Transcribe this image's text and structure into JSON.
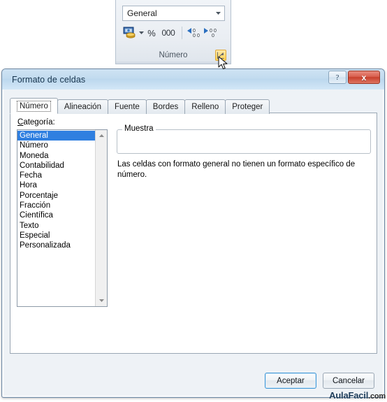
{
  "ribbon": {
    "number_format_combo": {
      "value": "General",
      "caret_icon": "chevron-down-icon"
    },
    "buttons": [
      {
        "name": "currency-format-button",
        "icon": "currency-icon",
        "label": ""
      },
      {
        "name": "currency-dropdown-button",
        "icon": "chevron-down-icon",
        "label": ""
      },
      {
        "name": "percent-style-button",
        "icon": "percent-icon",
        "label": "%"
      },
      {
        "name": "comma-style-button",
        "icon": "thousands-icon",
        "label": "000"
      },
      {
        "name": "increase-decimal-button",
        "icon": "increase-decimal-icon",
        "label": ""
      },
      {
        "name": "decrease-decimal-button",
        "icon": "decrease-decimal-icon",
        "label": ""
      }
    ],
    "group_label": "Número",
    "dialog_launcher": {
      "name": "dialog-launcher-button",
      "icon": "dialog-launcher-icon",
      "highlight_color": "#ffd050"
    }
  },
  "dialog": {
    "title": "Formato de celdas",
    "help_button": "?",
    "close_button": "x",
    "tabs": [
      {
        "label": "Número",
        "active": true
      },
      {
        "label": "Alineación",
        "active": false
      },
      {
        "label": "Fuente",
        "active": false
      },
      {
        "label": "Bordes",
        "active": false
      },
      {
        "label": "Relleno",
        "active": false
      },
      {
        "label": "Proteger",
        "active": false
      }
    ],
    "category": {
      "label_prefix": "C",
      "label_rest": "ategoría:",
      "items": [
        "General",
        "Número",
        "Moneda",
        "Contabilidad",
        "Fecha",
        "Hora",
        "Porcentaje",
        "Fracción",
        "Científica",
        "Texto",
        "Especial",
        "Personalizada"
      ],
      "selected": "General",
      "selected_bg": "#2f7fe0"
    },
    "sample": {
      "legend": "Muestra",
      "value": "",
      "description": "Las celdas con formato general no tienen un formato específico de número."
    },
    "footer": {
      "accept": "Aceptar",
      "cancel": "Cancelar"
    }
  },
  "watermark": {
    "brand": "AulaFacil",
    "suffix": ".com"
  }
}
